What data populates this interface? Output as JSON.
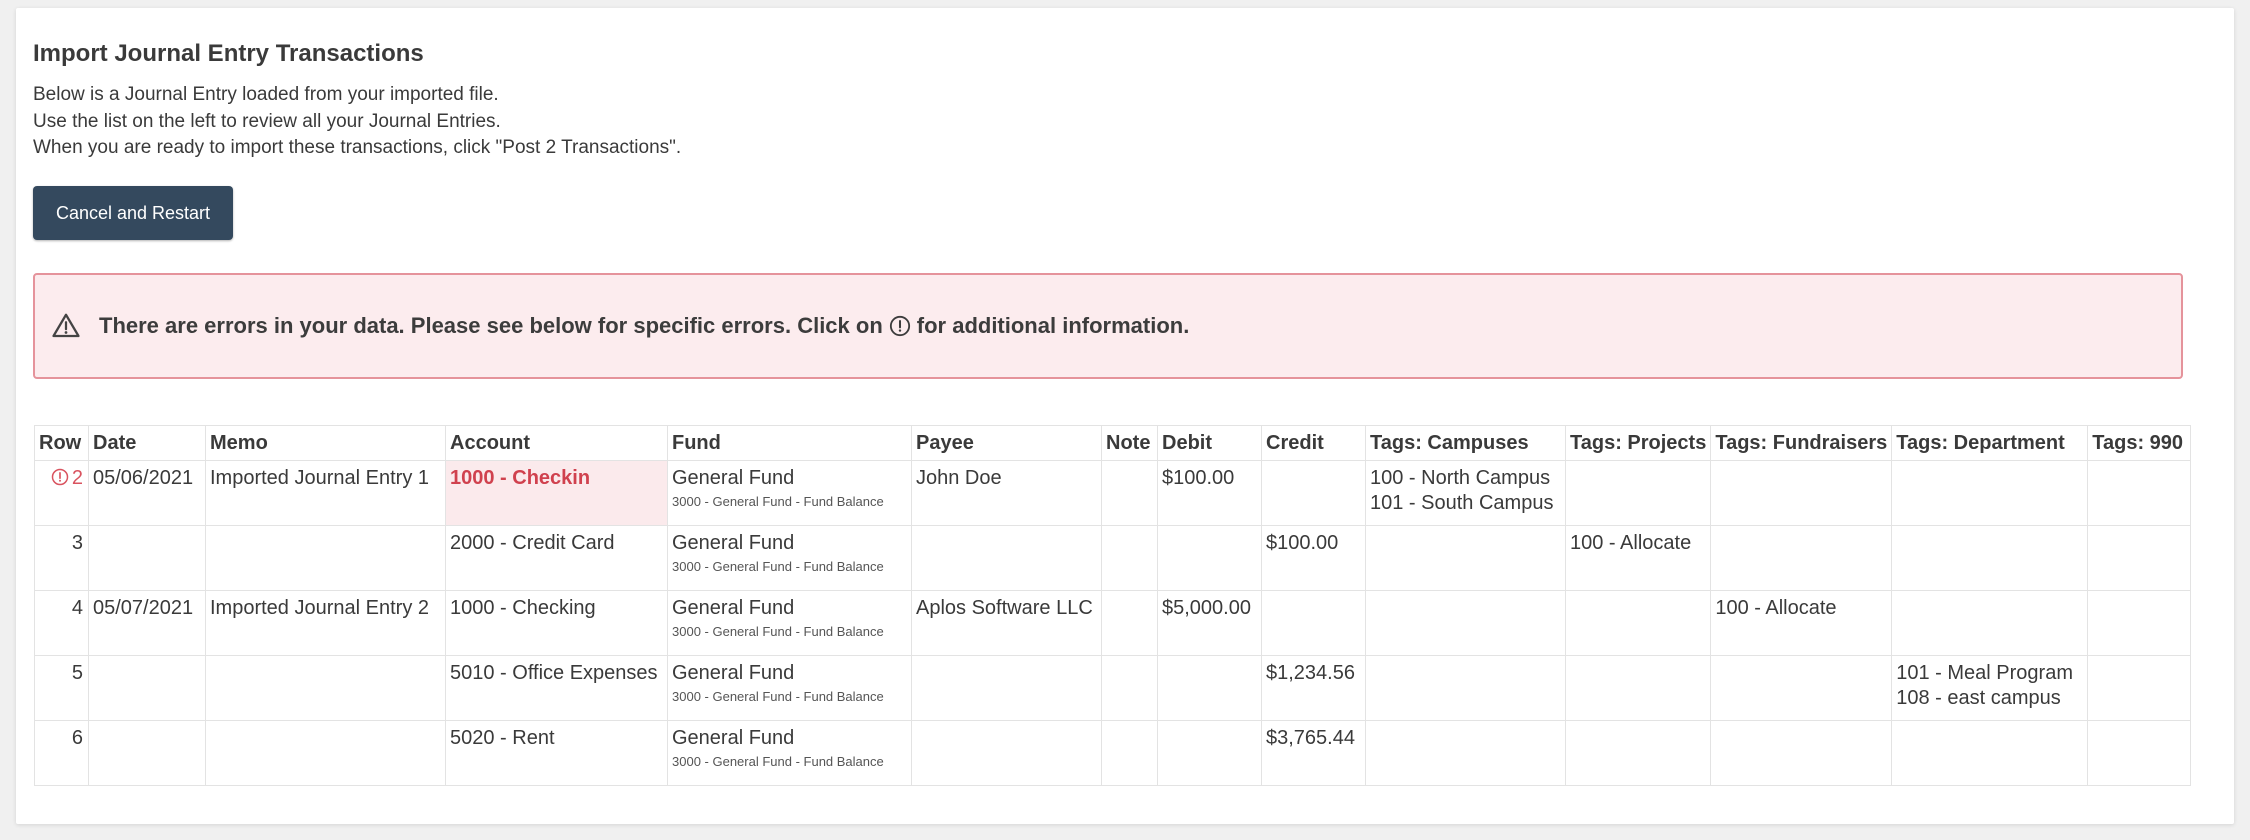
{
  "page": {
    "title": "Import Journal Entry Transactions",
    "description": [
      "Below is a Journal Entry loaded from your imported file.",
      "Use the list on the left to review all your Journal Entries.",
      "When you are ready to import these transactions, click \"Post 2 Transactions\"."
    ],
    "cancel_button_label": "Cancel and Restart"
  },
  "alert": {
    "text_before": "There are errors in your data. Please see below for specific errors. Click on",
    "text_after": "for additional information.",
    "icon": "warning-triangle-icon",
    "info_icon": "info-circle-icon",
    "colors": {
      "background": "#fcecee",
      "border": "#e5939b"
    }
  },
  "table": {
    "columns": [
      "Row",
      "Date",
      "Memo",
      "Account",
      "Fund",
      "Payee",
      "Note",
      "Debit",
      "Credit",
      "Tags: Campuses",
      "Tags: Projects",
      "Tags: Fundraisers",
      "Tags: Department",
      "Tags: 990"
    ],
    "rows": [
      {
        "row": "2",
        "error": true,
        "date": "05/06/2021",
        "memo": "Imported Journal Entry 1",
        "account": "1000 - Checkin",
        "fund": "General Fund",
        "fund_sub": "3000 - General Fund - Fund Balance",
        "payee": "John Doe",
        "note": "",
        "debit": "$100.00",
        "credit": "",
        "campuses": [
          "100 - North Campus",
          "101 - South Campus"
        ],
        "projects": [],
        "fundraisers": [],
        "department": [],
        "t990": ""
      },
      {
        "row": "3",
        "error": false,
        "date": "",
        "memo": "",
        "account": "2000 - Credit Card",
        "fund": "General Fund",
        "fund_sub": "3000 - General Fund - Fund Balance",
        "payee": "",
        "note": "",
        "debit": "",
        "credit": "$100.00",
        "campuses": [],
        "projects": [
          "100 - Allocate"
        ],
        "fundraisers": [],
        "department": [],
        "t990": ""
      },
      {
        "row": "4",
        "error": false,
        "date": "05/07/2021",
        "memo": "Imported Journal Entry 2",
        "account": "1000 - Checking",
        "fund": "General Fund",
        "fund_sub": "3000 - General Fund - Fund Balance",
        "payee": "Aplos Software LLC",
        "note": "",
        "debit": "$5,000.00",
        "credit": "",
        "campuses": [],
        "projects": [],
        "fundraisers": [
          "100 - Allocate"
        ],
        "department": [],
        "t990": ""
      },
      {
        "row": "5",
        "error": false,
        "date": "",
        "memo": "",
        "account": "5010 - Office Expenses",
        "fund": "General Fund",
        "fund_sub": "3000 - General Fund - Fund Balance",
        "payee": "",
        "note": "",
        "debit": "",
        "credit": "$1,234.56",
        "campuses": [],
        "projects": [],
        "fundraisers": [],
        "department": [
          "101 - Meal Program",
          "108 - east campus"
        ],
        "t990": ""
      },
      {
        "row": "6",
        "error": false,
        "date": "",
        "memo": "",
        "account": "5020 - Rent",
        "fund": "General Fund",
        "fund_sub": "3000 - General Fund - Fund Balance",
        "payee": "",
        "note": "",
        "debit": "",
        "credit": "$3,765.44",
        "campuses": [],
        "projects": [],
        "fundraisers": [],
        "department": [],
        "t990": ""
      }
    ]
  },
  "colors": {
    "button": "#34495e",
    "error_text": "#d9535f",
    "error_cell_bg": "#fbeaec"
  }
}
